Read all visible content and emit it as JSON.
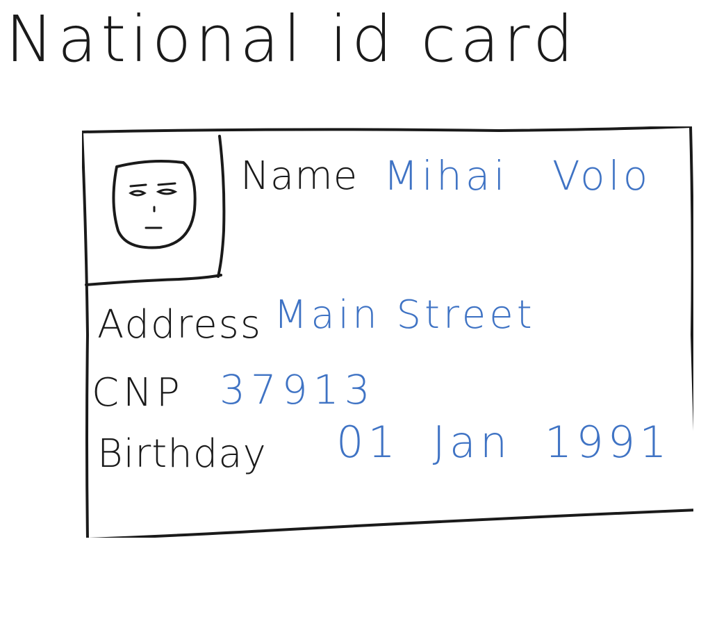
{
  "title": "National id card",
  "card": {
    "name_label": "Name",
    "name_value": "Mihai Volo",
    "address_label": "Address",
    "address_value": "Main Street",
    "cnp_label": "CNP",
    "cnp_value": "37913",
    "birthday_label": "Birthday",
    "birthday_value": "01 Jan 1991"
  },
  "colors": {
    "ink": "#1a1a1a",
    "value_ink": "#3f73c4",
    "background": "#ffffff"
  },
  "icons": {
    "photo": "face-icon"
  }
}
